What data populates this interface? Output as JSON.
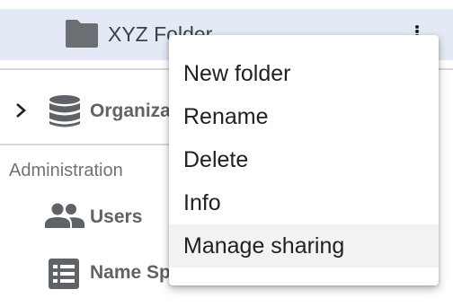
{
  "tree": {
    "selected_folder": {
      "label": "XYZ Folder",
      "icon": "folder-icon",
      "more_icon": "more-vertical-icon"
    },
    "organization": {
      "label": "Organizations",
      "icon": "database-icon",
      "expand_icon": "chevron-right-icon"
    },
    "administration": {
      "title": "Administration",
      "items": [
        {
          "label": "Users",
          "icon": "users-icon"
        },
        {
          "label": "Name Spaces",
          "icon": "list-icon"
        }
      ]
    }
  },
  "context_menu": {
    "items": [
      {
        "label": "New folder"
      },
      {
        "label": "Rename"
      },
      {
        "label": "Delete"
      },
      {
        "label": "Info"
      },
      {
        "label": "Manage sharing",
        "hovered": true
      }
    ]
  },
  "colors": {
    "selected_row_bg": "#e3eaf6",
    "icon_gray": "#5f6368",
    "text_dark": "#202124",
    "menu_hover_bg": "#f3f3f3"
  }
}
